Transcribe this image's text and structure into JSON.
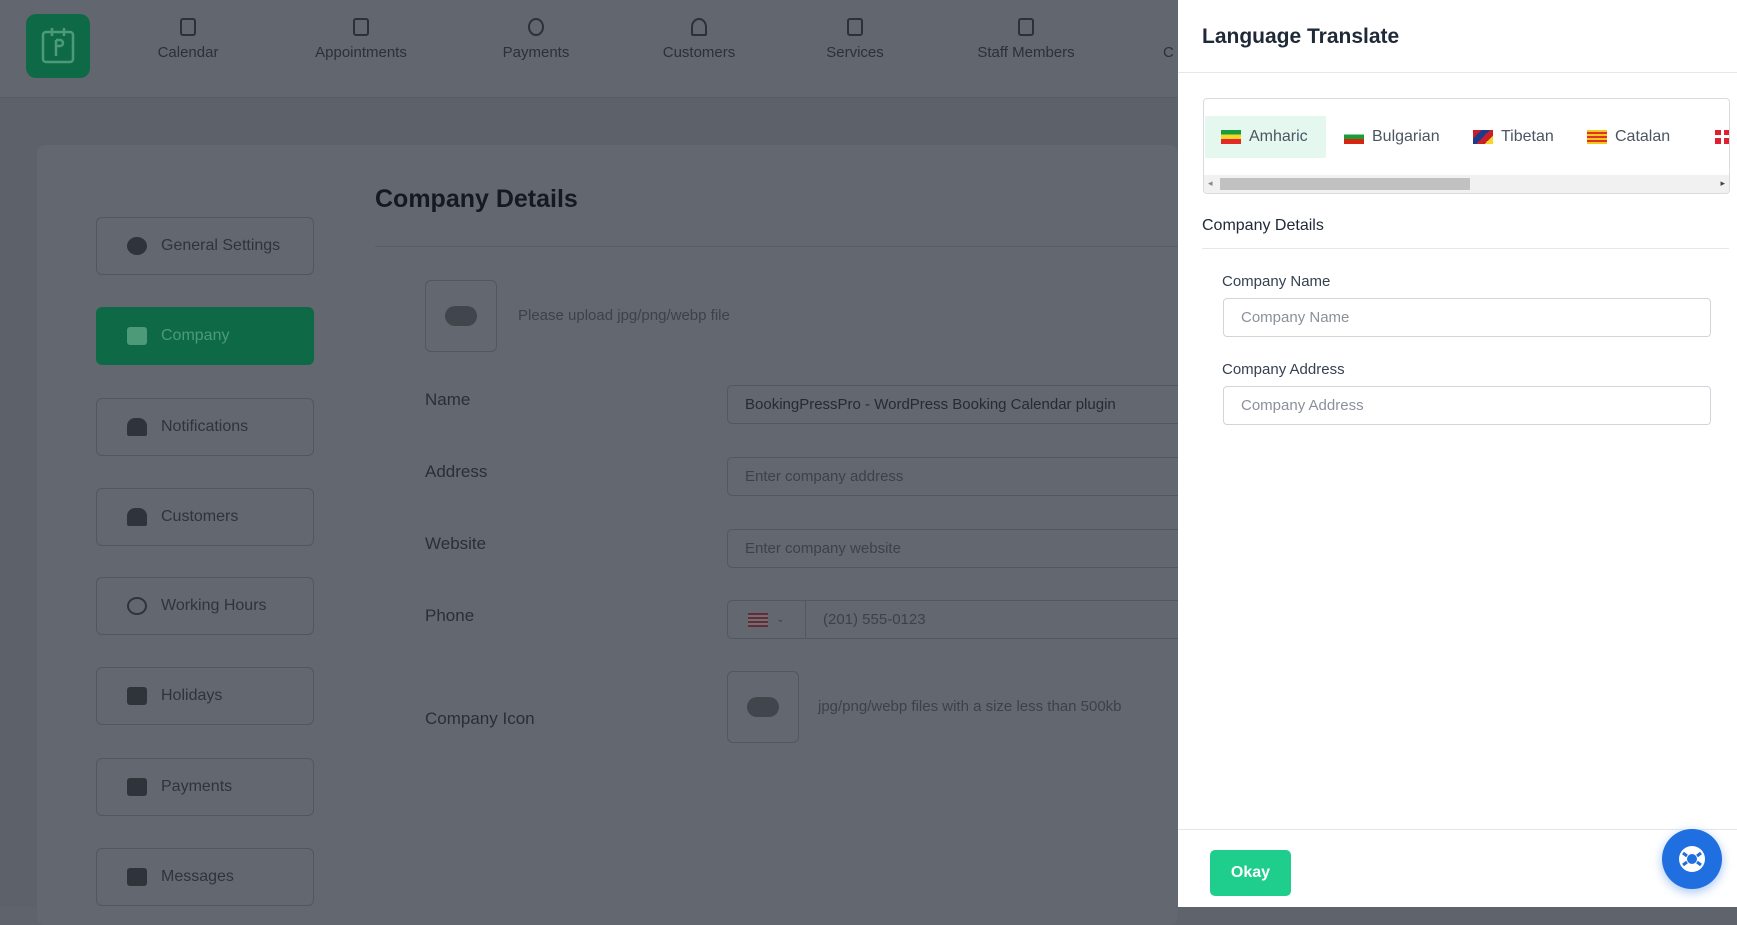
{
  "header": {
    "nav": [
      {
        "label": "Calendar",
        "icon": "calendar-icon"
      },
      {
        "label": "Appointments",
        "icon": "calendar-check-icon"
      },
      {
        "label": "Payments",
        "icon": "dollar-icon"
      },
      {
        "label": "Customers",
        "icon": "users-icon"
      },
      {
        "label": "Services",
        "icon": "list-icon"
      },
      {
        "label": "Staff Members",
        "icon": "badge-icon"
      },
      {
        "label": "C",
        "icon": "more-icon"
      }
    ]
  },
  "sidebar": {
    "items": [
      {
        "label": "General Settings",
        "icon": "gear-icon"
      },
      {
        "label": "Company",
        "icon": "building-icon",
        "active": true
      },
      {
        "label": "Notifications",
        "icon": "bell-icon"
      },
      {
        "label": "Customers",
        "icon": "users-icon"
      },
      {
        "label": "Working Hours",
        "icon": "clock-icon"
      },
      {
        "label": "Holidays",
        "icon": "calendar-icon"
      },
      {
        "label": "Payments",
        "icon": "wallet-icon"
      },
      {
        "label": "Messages",
        "icon": "chat-icon"
      }
    ]
  },
  "main": {
    "title": "Company Details",
    "upload_hint": "Please upload jpg/png/webp file",
    "fields": {
      "name_label": "Name",
      "name_value": "BookingPressPro - WordPress Booking Calendar plugin",
      "address_label": "Address",
      "address_placeholder": "Enter company address",
      "website_label": "Website",
      "website_placeholder": "Enter company website",
      "phone_label": "Phone",
      "phone_placeholder": "(201) 555-0123",
      "icon_label": "Company Icon",
      "icon_hint": "jpg/png/webp files with a size less than 500kb"
    }
  },
  "drawer": {
    "title": "Language Translate",
    "languages": [
      {
        "label": "Amharic",
        "active": true
      },
      {
        "label": "Bulgarian"
      },
      {
        "label": "Tibetan"
      },
      {
        "label": "Catalan"
      },
      {
        "label": ""
      }
    ],
    "section_title": "Company Details",
    "company_name_label": "Company Name",
    "company_name_placeholder": "Company Name",
    "company_address_label": "Company Address",
    "company_address_placeholder": "Company Address",
    "okay_label": "Okay"
  },
  "colors": {
    "brand": "#12a56b",
    "okay": "#1fce8c",
    "help": "#1f6fe0",
    "active_tab": "#e4f8ef"
  }
}
